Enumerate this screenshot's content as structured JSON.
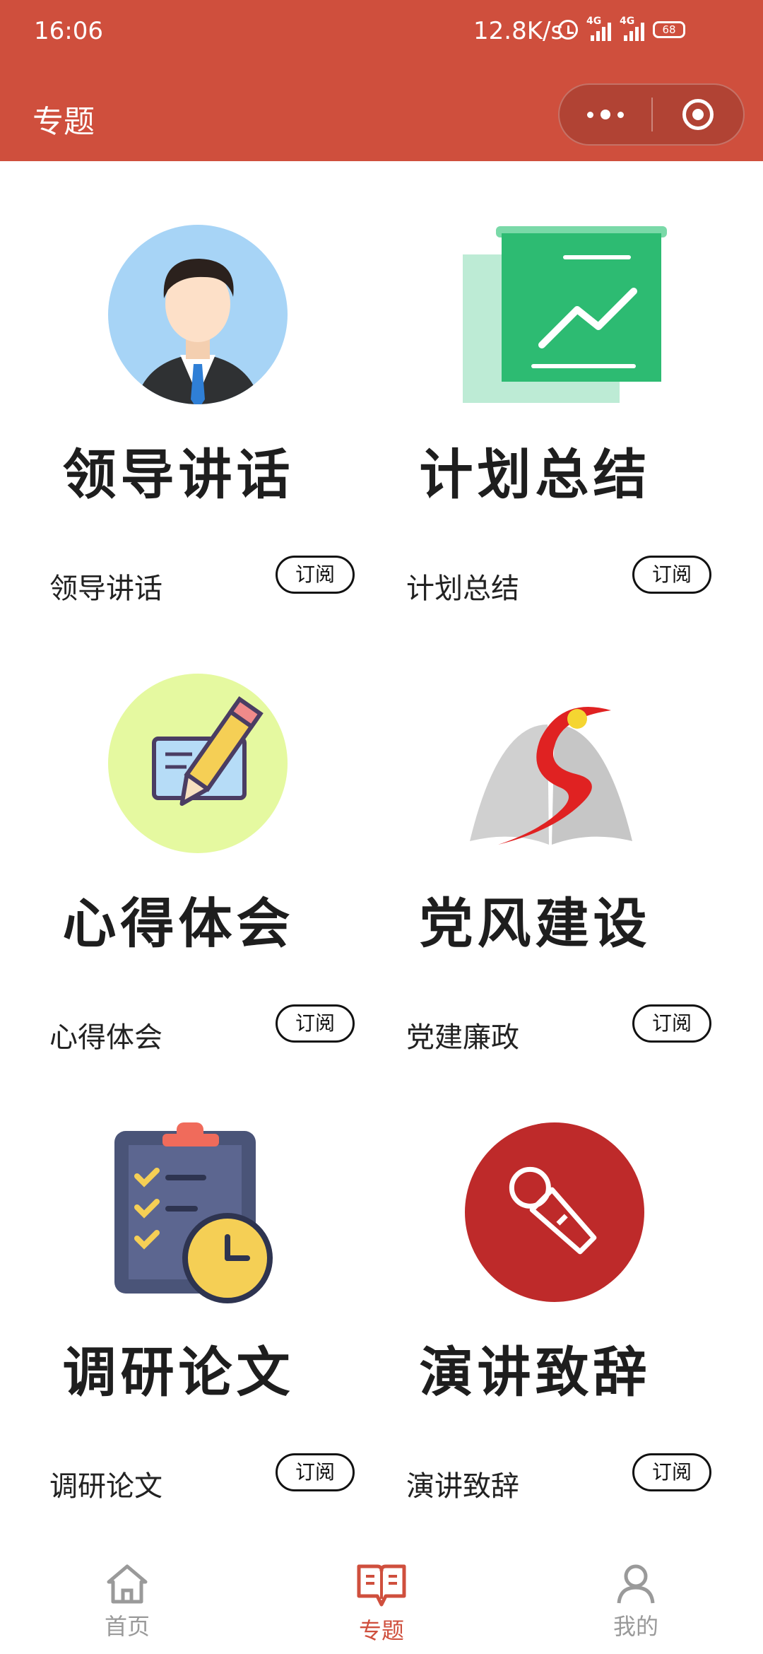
{
  "status": {
    "time": "16:06",
    "speed": "12.8K/s",
    "sim1": "4G",
    "sim2": "4G",
    "battery": "68"
  },
  "header": {
    "title": "专题"
  },
  "colors": {
    "brand": "#cf4f3d",
    "tab_inactive": "#9a9a9a"
  },
  "cards": [
    {
      "title": "领导讲话",
      "name": "领导讲话",
      "subscribe": "订阅",
      "icon": "leader-avatar-icon"
    },
    {
      "title": "计划总结",
      "name": "计划总结",
      "subscribe": "订阅",
      "icon": "chart-board-icon"
    },
    {
      "title": "心得体会",
      "name": "心得体会",
      "subscribe": "订阅",
      "icon": "pencil-note-icon"
    },
    {
      "title": "党风建设",
      "name": "党建廉政",
      "subscribe": "订阅",
      "icon": "party-book-icon"
    },
    {
      "title": "调研论文",
      "name": "调研论文",
      "subscribe": "订阅",
      "icon": "clipboard-clock-icon"
    },
    {
      "title": "演讲致辞",
      "name": "演讲致辞",
      "subscribe": "订阅",
      "icon": "microphone-icon"
    }
  ],
  "tabbar": {
    "active": "专题",
    "items": [
      {
        "label": "首页",
        "icon": "home-icon"
      },
      {
        "label": "专题",
        "icon": "book-icon"
      },
      {
        "label": "我的",
        "icon": "user-icon"
      }
    ]
  }
}
